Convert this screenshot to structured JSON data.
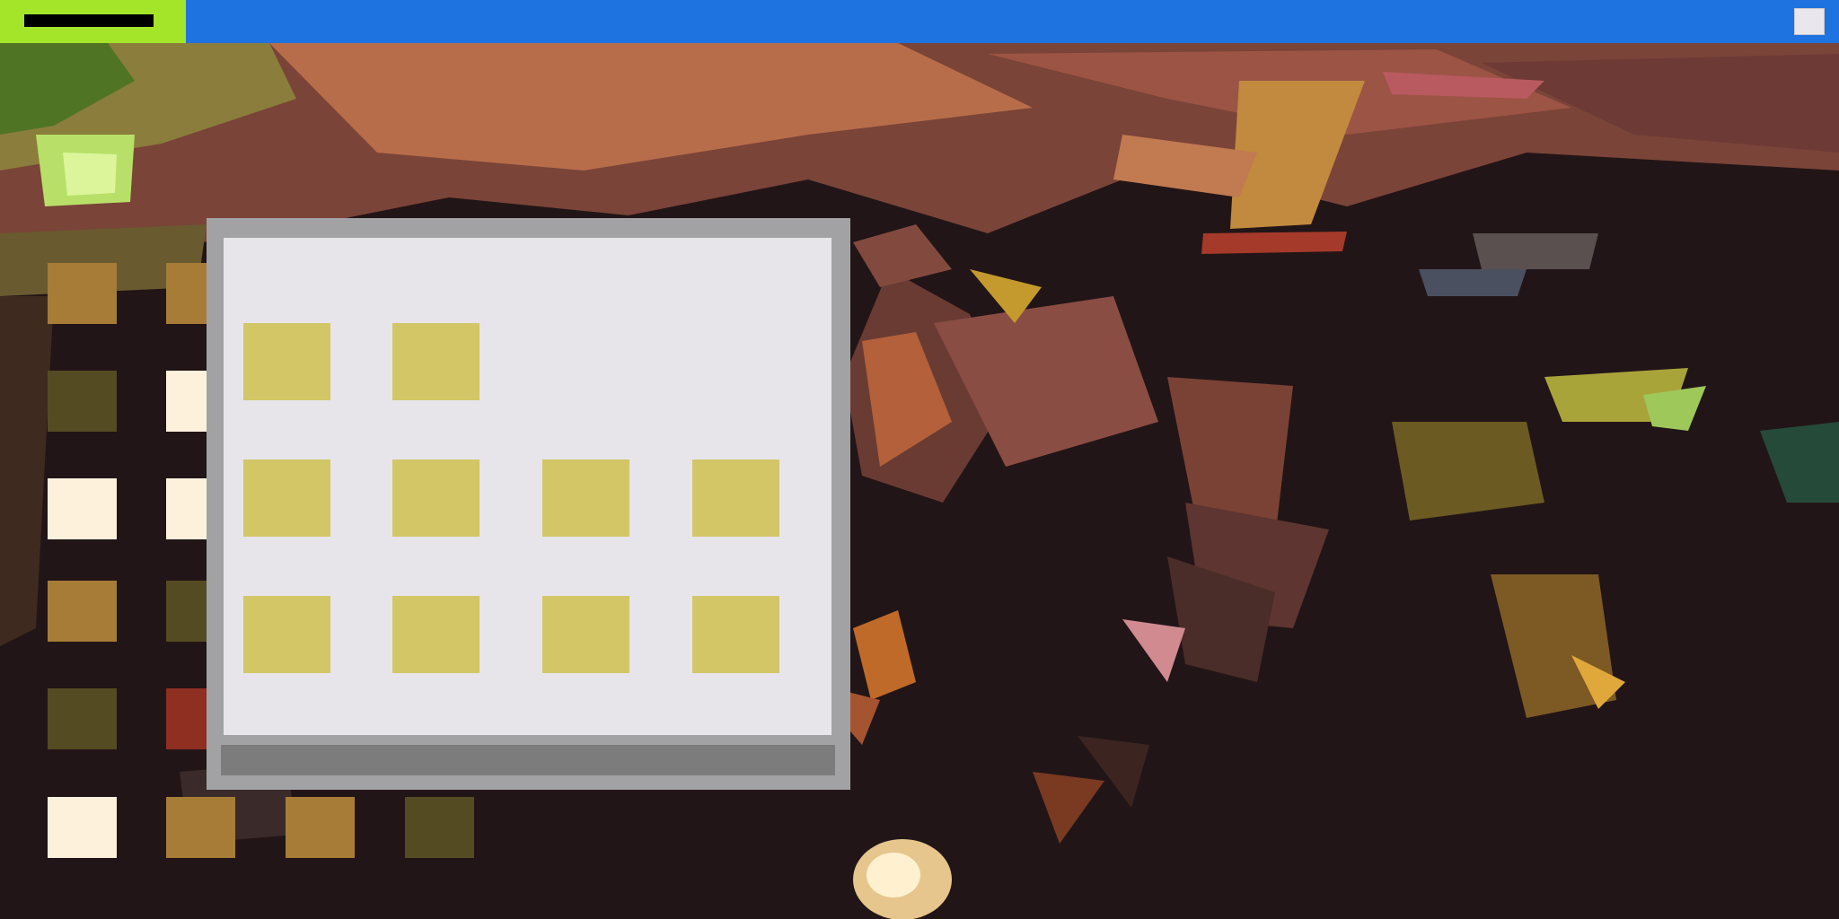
{
  "theme": {
    "taskbar": "#1f73e0",
    "start_area": "#a4e52a",
    "window_frame": "#a2a2a4",
    "window_body": "#e7e5ea",
    "status_bar": "#7c7c7c",
    "tile": "#d3c666"
  },
  "taskbar": {
    "start_icon": "start-icon",
    "tray_icon": "tray-icon"
  },
  "desktop_icons": [
    {
      "name": "desktop-icon",
      "color": "#a67c36"
    },
    {
      "name": "desktop-icon",
      "color": "#a67c36"
    },
    {
      "name": "desktop-icon",
      "color": "#554b22"
    },
    {
      "name": "desktop-icon",
      "color": "#fdf1dc"
    },
    {
      "name": "desktop-icon",
      "color": "#fdf1dc"
    },
    {
      "name": "desktop-icon",
      "color": "#fdf1dc"
    },
    {
      "name": "desktop-icon",
      "color": "#a67c36"
    },
    {
      "name": "desktop-icon",
      "color": "#554b22"
    },
    {
      "name": "desktop-icon",
      "color": "#554b22"
    },
    {
      "name": "desktop-icon",
      "color": "#8e2f22"
    },
    {
      "name": "desktop-icon",
      "color": "#fdf1dc"
    },
    {
      "name": "desktop-icon",
      "color": "#a67c36"
    },
    {
      "name": "desktop-icon",
      "color": "#a67c36"
    },
    {
      "name": "desktop-icon",
      "color": "#554b22"
    }
  ],
  "window": {
    "tiles": [
      {
        "name": "app-tile"
      },
      {
        "name": "app-tile"
      },
      {
        "name": "app-tile"
      },
      {
        "name": "app-tile"
      },
      {
        "name": "app-tile"
      },
      {
        "name": "app-tile"
      },
      {
        "name": "app-tile"
      },
      {
        "name": "app-tile"
      },
      {
        "name": "app-tile"
      },
      {
        "name": "app-tile"
      }
    ]
  }
}
